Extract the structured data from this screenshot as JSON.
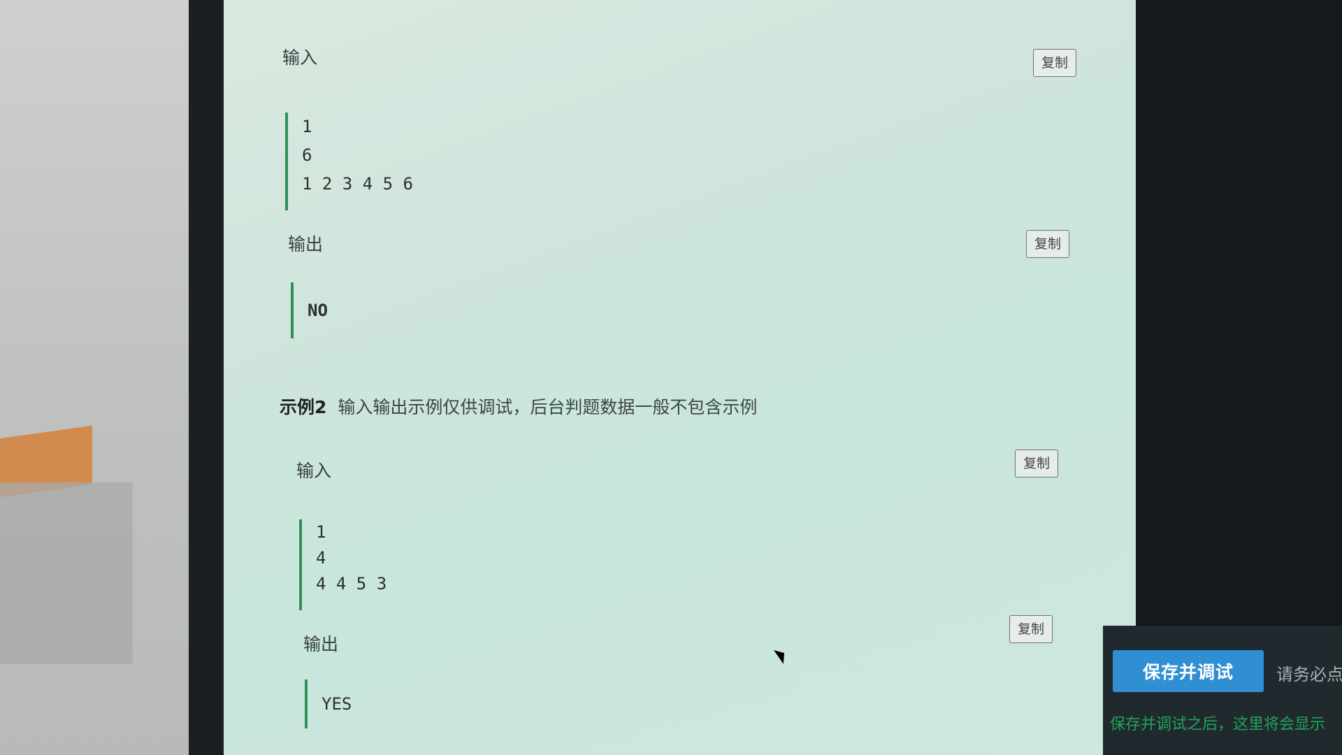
{
  "samples": [
    {
      "input_label": "输入",
      "input_lines": [
        "1",
        "6",
        "1 2 3 4 5 6"
      ],
      "output_label": "输出",
      "output_lines": [
        "NO"
      ],
      "copy_label": "复制"
    },
    {
      "header_title": "示例2",
      "header_note": "输入输出示例仅供调试，后台判题数据一般不包含示例",
      "input_label": "输入",
      "input_lines": [
        "1",
        "4",
        "4 4 5 3"
      ],
      "output_label": "输出",
      "output_lines": [
        "YES"
      ],
      "copy_label": "复制"
    }
  ],
  "actions": {
    "save_debug_label": "保存并调试",
    "must_hint": "请务必点",
    "save_note": "保存并调试之后，这里将会显示"
  }
}
